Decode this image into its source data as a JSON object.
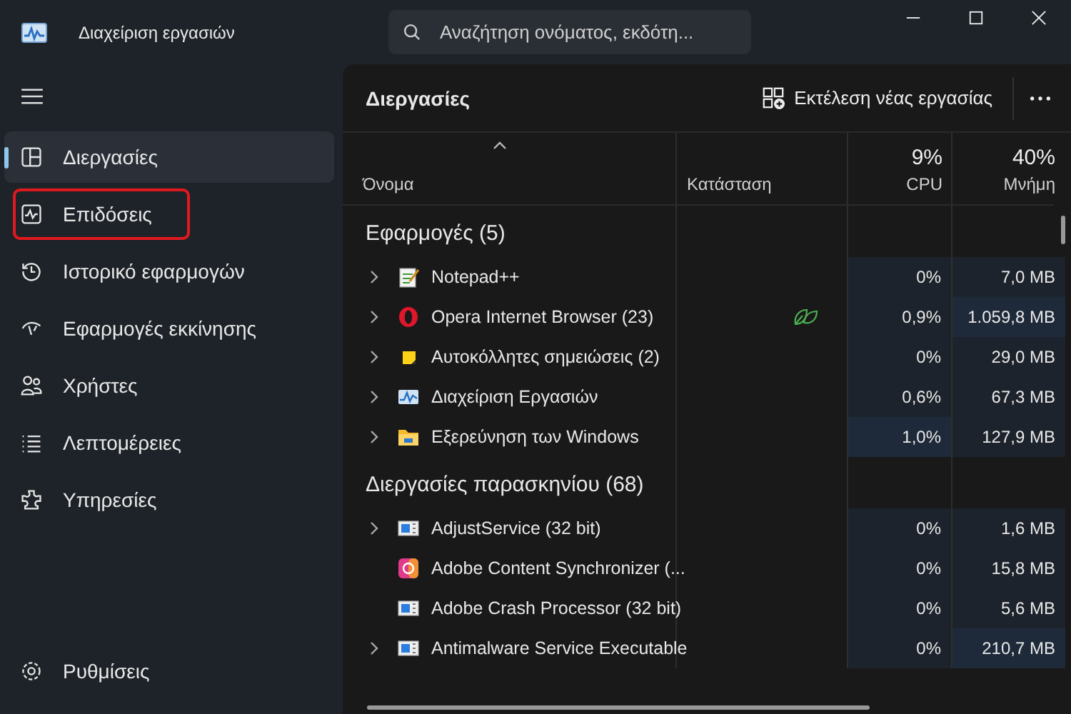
{
  "window": {
    "title": "Διαχείριση εργασιών"
  },
  "search": {
    "placeholder": "Αναζήτηση ονόματος, εκδότη..."
  },
  "sidebar": {
    "items": [
      {
        "label": "Διεργασίες",
        "kind": "processes",
        "selected": true,
        "outlined": false
      },
      {
        "label": "Επιδόσεις",
        "kind": "performance",
        "selected": false,
        "outlined": true
      },
      {
        "label": "Ιστορικό εφαρμογών",
        "kind": "history",
        "selected": false,
        "outlined": false
      },
      {
        "label": "Εφαρμογές εκκίνησης",
        "kind": "startup",
        "selected": false,
        "outlined": false
      },
      {
        "label": "Χρήστες",
        "kind": "users",
        "selected": false,
        "outlined": false
      },
      {
        "label": "Λεπτομέρειες",
        "kind": "details",
        "selected": false,
        "outlined": false
      },
      {
        "label": "Υπηρεσίες",
        "kind": "services",
        "selected": false,
        "outlined": false
      }
    ],
    "settings": "Ρυθμίσεις"
  },
  "page": {
    "title": "Διεργασίες",
    "run_task": "Εκτέλεση νέας εργασίας"
  },
  "table": {
    "columns": [
      {
        "label": "Όνομα"
      },
      {
        "label": "Κατάσταση"
      },
      {
        "label": "CPU",
        "total": "9%"
      },
      {
        "label": "Μνήμη",
        "total": "40%"
      }
    ],
    "groups": [
      {
        "title": "Εφαρμογές (5)",
        "rows": [
          {
            "name": "Notepad++",
            "kind": "notepad",
            "expandable": true,
            "efficiency": false,
            "cpu": "0%",
            "memory": "7,0 MB",
            "cpu_high": false,
            "memory_high": false
          },
          {
            "name": "Opera Internet Browser (23)",
            "kind": "opera",
            "expandable": true,
            "efficiency": true,
            "cpu": "0,9%",
            "memory": "1.059,8 MB",
            "cpu_high": false,
            "memory_high": true
          },
          {
            "name": "Αυτοκόλλητες σημειώσεις (2)",
            "kind": "sticky",
            "expandable": true,
            "efficiency": false,
            "cpu": "0%",
            "memory": "29,0 MB",
            "cpu_high": false,
            "memory_high": false
          },
          {
            "name": "Διαχείριση Εργασιών",
            "kind": "taskmgr",
            "expandable": true,
            "efficiency": false,
            "cpu": "0,6%",
            "memory": "67,3 MB",
            "cpu_high": false,
            "memory_high": false
          },
          {
            "name": "Εξερεύνηση των Windows",
            "kind": "explorer",
            "expandable": true,
            "efficiency": false,
            "cpu": "1,0%",
            "memory": "127,9 MB",
            "cpu_high": true,
            "memory_high": false
          }
        ]
      },
      {
        "title": "Διεργασίες παρασκηνίου (68)",
        "rows": [
          {
            "name": "AdjustService (32 bit)",
            "kind": "service",
            "expandable": true,
            "efficiency": false,
            "cpu": "0%",
            "memory": "1,6 MB",
            "cpu_high": false,
            "memory_high": false
          },
          {
            "name": "Adobe Content Synchronizer (...",
            "kind": "adobe",
            "expandable": false,
            "efficiency": false,
            "cpu": "0%",
            "memory": "15,8 MB",
            "cpu_high": false,
            "memory_high": false
          },
          {
            "name": "Adobe Crash Processor (32 bit)",
            "kind": "service",
            "expandable": false,
            "efficiency": false,
            "cpu": "0%",
            "memory": "5,6 MB",
            "cpu_high": false,
            "memory_high": false
          },
          {
            "name": "Antimalware Service Executable",
            "kind": "service",
            "expandable": true,
            "efficiency": false,
            "cpu": "0%",
            "memory": "210,7 MB",
            "cpu_high": false,
            "memory_high": true
          }
        ]
      }
    ]
  }
}
